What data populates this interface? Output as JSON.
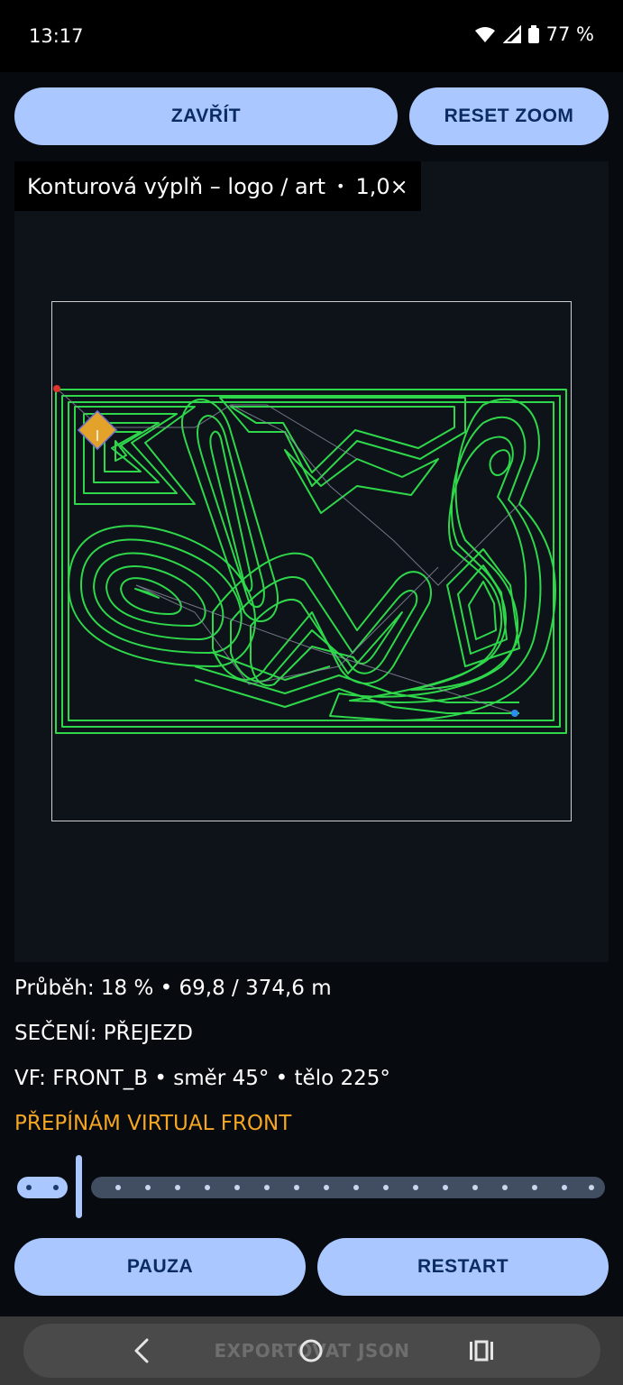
{
  "status_bar": {
    "time": "13:17",
    "battery": "77 %"
  },
  "buttons": {
    "close": "ZAVŘÍT",
    "reset_zoom": "RESET ZOOM",
    "pause": "PAUZA",
    "restart": "RESTART",
    "export": "EXPORTOVAT JSON"
  },
  "viewer": {
    "title": "Konturová výplň – logo / art",
    "separator": "•",
    "zoom": "1,0×"
  },
  "info": {
    "progress": "Průběh: 18 %  •  69,8 / 374,6 m",
    "mode": "SEČENÍ: PŘEJEZD",
    "vf": "VF: FRONT_B  •  směr 45°  •  tělo 225°",
    "warning": "PŘEPÍNÁM VIRTUAL FRONT"
  },
  "progress_value": 0.18,
  "colors": {
    "accent": "#aac7ff",
    "accent_text": "#0b2b63",
    "path": "#2ed84a",
    "warning": "#f5a623",
    "robot": "#e3a22a",
    "start_marker": "#e0342c",
    "end_marker": "#2d8cf0"
  }
}
